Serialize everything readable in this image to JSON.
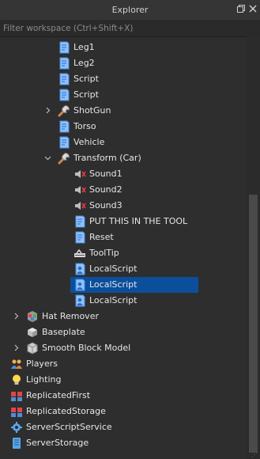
{
  "panel": {
    "title": "Explorer",
    "restore_icon": "restore-window-icon",
    "close_icon": "close-icon"
  },
  "filter": {
    "placeholder": "Filter workspace (Ctrl+Shift+X)",
    "value": ""
  },
  "tree": [
    {
      "label": "Leg1",
      "icon": "script-icon",
      "depth": 3,
      "arrow": ""
    },
    {
      "label": "Leg2",
      "icon": "script-icon",
      "depth": 3,
      "arrow": ""
    },
    {
      "label": "Script",
      "icon": "script-icon",
      "depth": 3,
      "arrow": ""
    },
    {
      "label": "Script",
      "icon": "script-icon",
      "depth": 3,
      "arrow": ""
    },
    {
      "label": "ShotGun",
      "icon": "tool-icon",
      "depth": 3,
      "arrow": "collapsed"
    },
    {
      "label": "Torso",
      "icon": "script-icon",
      "depth": 3,
      "arrow": ""
    },
    {
      "label": "Vehicle",
      "icon": "script-icon",
      "depth": 3,
      "arrow": ""
    },
    {
      "label": "Transform (Car)",
      "icon": "tool-icon",
      "depth": 3,
      "arrow": "expanded"
    },
    {
      "label": "Sound1",
      "icon": "sound-icon",
      "depth": 4,
      "arrow": ""
    },
    {
      "label": "Sound2",
      "icon": "sound-icon",
      "depth": 4,
      "arrow": ""
    },
    {
      "label": "Sound3",
      "icon": "sound-icon",
      "depth": 4,
      "arrow": ""
    },
    {
      "label": "PUT THIS IN THE TOOL",
      "icon": "script-icon",
      "depth": 4,
      "arrow": ""
    },
    {
      "label": "Reset",
      "icon": "script-icon",
      "depth": 4,
      "arrow": ""
    },
    {
      "label": "ToolTip",
      "icon": "tooltip-icon",
      "depth": 4,
      "arrow": ""
    },
    {
      "label": "LocalScript",
      "icon": "localscript-icon",
      "depth": 4,
      "arrow": ""
    },
    {
      "label": "LocalScript",
      "icon": "localscript-icon",
      "depth": 4,
      "arrow": "",
      "selected": true
    },
    {
      "label": "LocalScript",
      "icon": "localscript-icon",
      "depth": 4,
      "arrow": ""
    },
    {
      "label": "Hat Remover",
      "icon": "model-icon",
      "depth": 1,
      "arrow": "collapsed"
    },
    {
      "label": "Baseplate",
      "icon": "part-icon",
      "depth": 1,
      "arrow": ""
    },
    {
      "label": "Smooth Block Model",
      "icon": "model-gray-icon",
      "depth": 1,
      "arrow": "collapsed"
    },
    {
      "label": "Players",
      "icon": "players-icon",
      "depth": 0,
      "arrow": ""
    },
    {
      "label": "Lighting",
      "icon": "lighting-icon",
      "depth": 0,
      "arrow": ""
    },
    {
      "label": "ReplicatedFirst",
      "icon": "replicated-icon",
      "depth": 0,
      "arrow": ""
    },
    {
      "label": "ReplicatedStorage",
      "icon": "replicated-icon",
      "depth": 0,
      "arrow": ""
    },
    {
      "label": "ServerScriptService",
      "icon": "server-script-service-icon",
      "depth": 0,
      "arrow": ""
    },
    {
      "label": "ServerStorage",
      "icon": "server-storage-icon",
      "depth": 0,
      "arrow": ""
    }
  ],
  "colors": {
    "background": "#2e2e2e",
    "selection": "#0b4f9c",
    "text": "#e6e6e6"
  }
}
